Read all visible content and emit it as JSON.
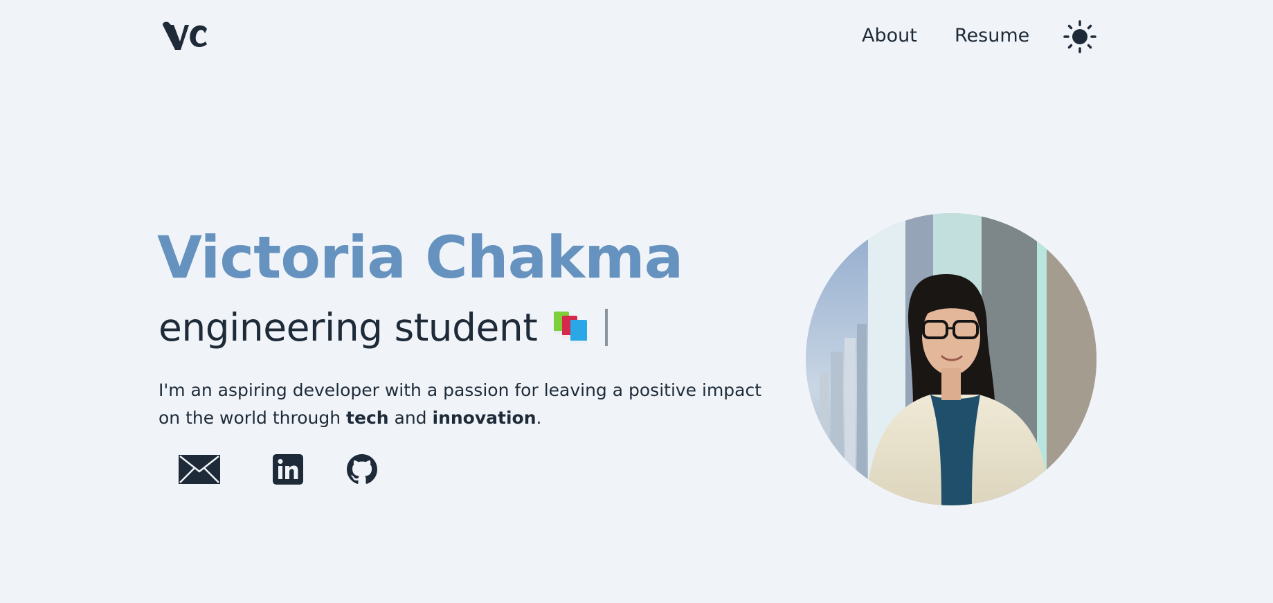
{
  "nav": {
    "logo_text": "vc",
    "links": [
      {
        "label": "About"
      },
      {
        "label": "Resume"
      }
    ],
    "theme_icon": "sun-icon"
  },
  "hero": {
    "name": "Victoria Chakma",
    "role": "engineering student",
    "role_emoji_icon": "books-icon",
    "bio_prefix": "I'm an aspiring developer with a passion for leaving a positive impact on the world through ",
    "bio_bold_1": "tech",
    "bio_middle": " and ",
    "bio_bold_2": "innovation",
    "bio_suffix": "."
  },
  "social": [
    {
      "icon": "mail-icon"
    },
    {
      "icon": "linkedin-icon"
    },
    {
      "icon": "github-icon"
    }
  ],
  "colors": {
    "background": "#f0f4f8",
    "accent": "#6592bf",
    "text": "#1e2a38"
  }
}
